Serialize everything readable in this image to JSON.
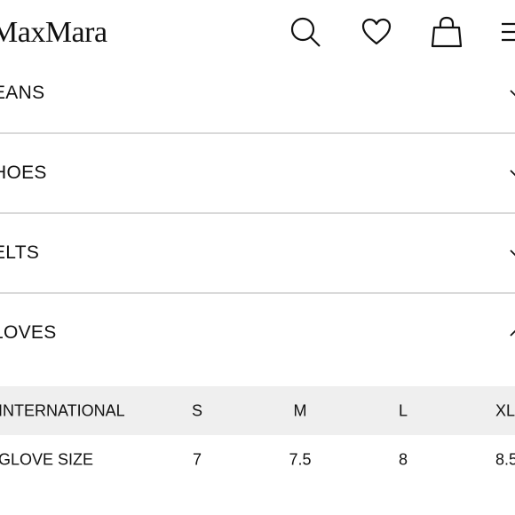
{
  "header": {
    "logo": "MaxMara",
    "icons": [
      "search-icon",
      "heart-icon",
      "bag-icon",
      "menu-icon"
    ]
  },
  "accordion": [
    {
      "label": "EANS",
      "expanded": false
    },
    {
      "label": "HOES",
      "expanded": false
    },
    {
      "label": "ELTS",
      "expanded": false
    },
    {
      "label": "LOVES",
      "expanded": true
    }
  ],
  "size_table": {
    "header": [
      "INTERNATIONAL",
      "S",
      "M",
      "L",
      "XL"
    ],
    "rows": [
      [
        "GLOVE SIZE",
        "7",
        "7.5",
        "8",
        "8.5"
      ]
    ]
  }
}
